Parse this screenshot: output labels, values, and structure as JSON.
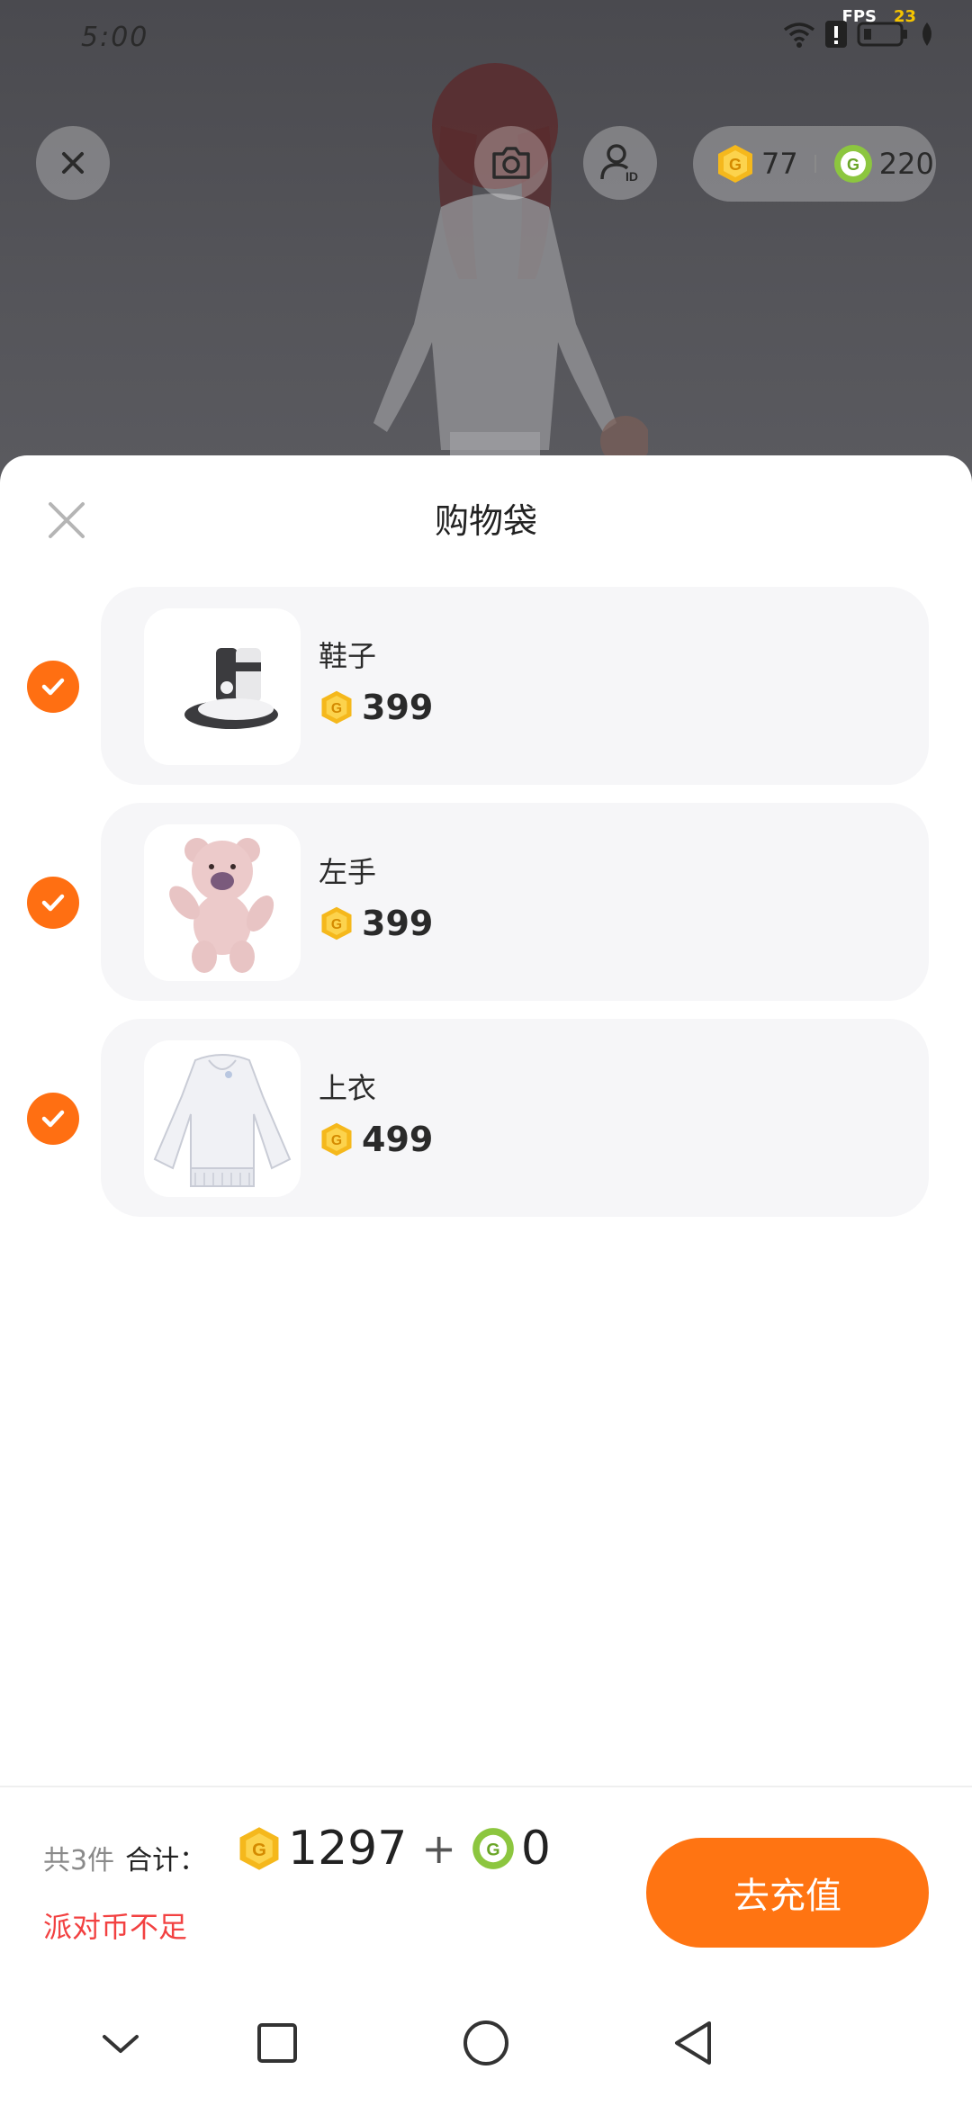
{
  "status_bar": {
    "time": "5:00",
    "fps_label": "FPS",
    "fps_value": "23"
  },
  "top": {
    "gold_coins": "77",
    "green_coins": "220"
  },
  "sheet": {
    "title": "购物袋",
    "items": [
      {
        "name": "鞋子",
        "price": "399",
        "checked": true,
        "thumb": "shoes-icon"
      },
      {
        "name": "左手",
        "price": "399",
        "checked": true,
        "thumb": "teddy-bear-icon"
      },
      {
        "name": "上衣",
        "price": "499",
        "checked": true,
        "thumb": "white-hoodie-icon"
      }
    ]
  },
  "footer": {
    "count": "共3件",
    "sum_label": "合计：",
    "total_gold": "1297",
    "plus": "+",
    "total_green": "0",
    "warning": "派对币不足",
    "recharge_label": "去充值"
  },
  "colors": {
    "accent": "#ff7412",
    "check": "#ff6f12",
    "warning": "#f24141",
    "gold_coin": "#f5b81c",
    "green_coin": "#8cc63f"
  }
}
